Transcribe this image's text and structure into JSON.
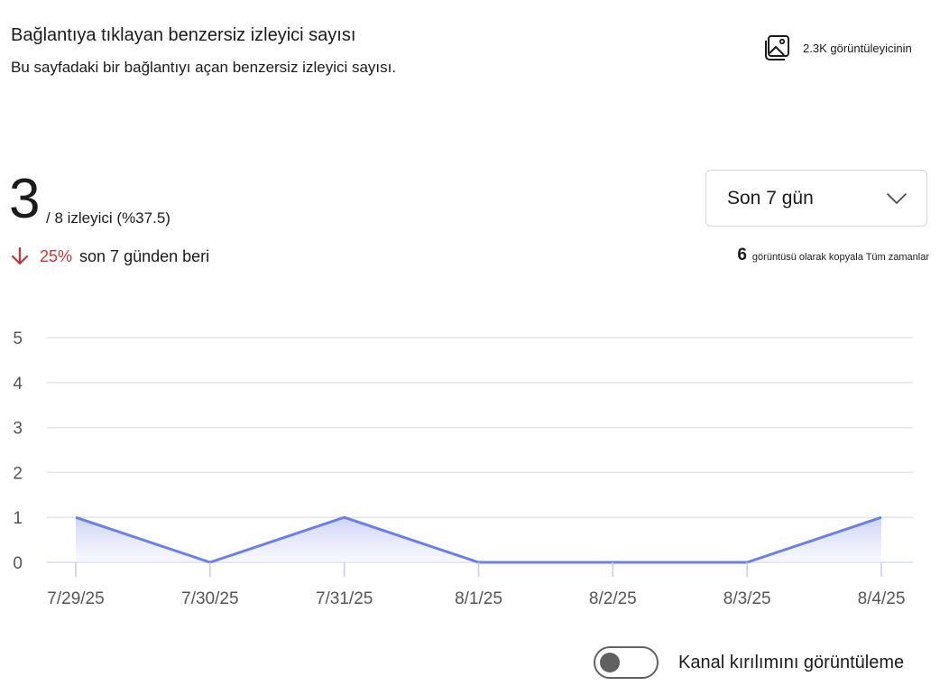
{
  "header": {
    "title": "Bağlantıya tıklayan benzersiz izleyici sayısı",
    "subtitle": "Bu sayfadaki bir bağlantıyı açan benzersiz izleyici sayısı."
  },
  "image_views": {
    "icon": "image-gallery-icon",
    "text": "2.3K görüntüleyicinin"
  },
  "summary": {
    "value": "3",
    "viewers_text": "/ 8 izleyici (%37.5)",
    "change_icon": "arrow-down-icon",
    "change_pct": "25%",
    "change_color": "#d13438",
    "change_since": "son 7 günden beri"
  },
  "period_dropdown": {
    "selected": "Son 7 gün",
    "icon": "chevron-down-icon"
  },
  "copy_views": {
    "count": "6",
    "text": "görüntüsü olarak kopyala Tüm zamanlar"
  },
  "chart_data": {
    "type": "area",
    "categories": [
      "7/29/25",
      "7/30/25",
      "7/31/25",
      "8/1/25",
      "8/2/25",
      "8/3/25",
      "8/4/25"
    ],
    "values": [
      1,
      0,
      1,
      0,
      0,
      0,
      1
    ],
    "y_ticks": [
      0,
      1,
      2,
      3,
      4,
      5
    ],
    "ylim": [
      0,
      5
    ],
    "grid": true,
    "line_color": "#6b7fe8",
    "fill_color": "#e3e7fb"
  },
  "footer": {
    "toggle_label": "Kanal kırılımını görüntüleme",
    "toggle_on": false
  }
}
